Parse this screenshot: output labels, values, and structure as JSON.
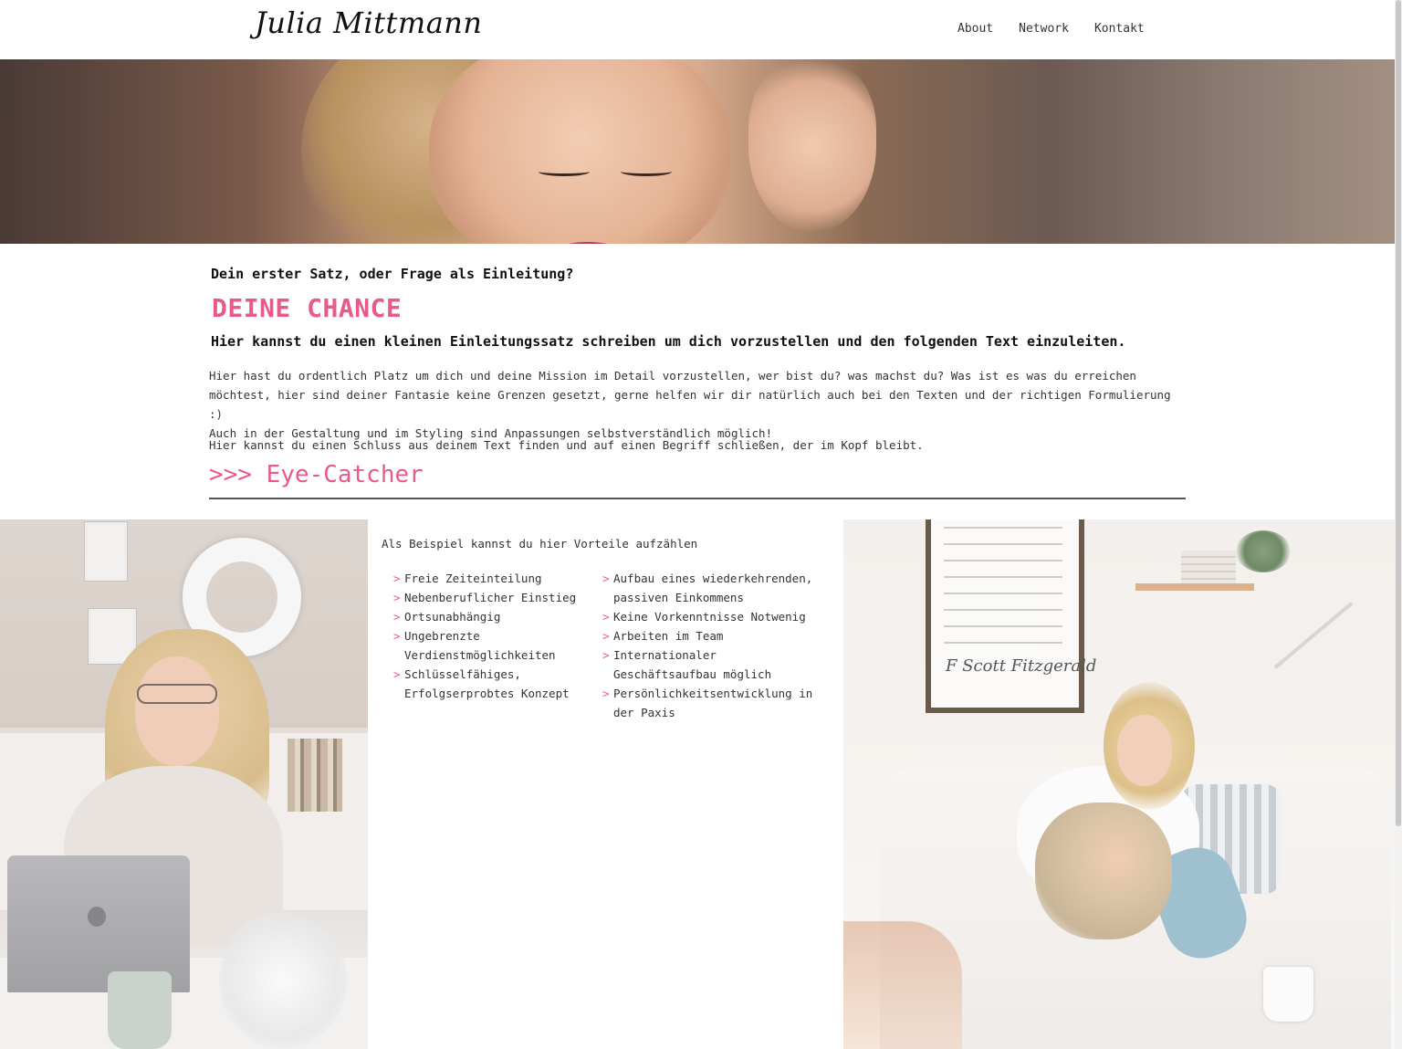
{
  "header": {
    "logo": "Julia Mittmann",
    "nav": [
      {
        "label": "About"
      },
      {
        "label": "Network"
      },
      {
        "label": "Kontakt"
      }
    ]
  },
  "intro": {
    "question": "Dein erster Satz, oder Frage als Einleitung?",
    "title": "DEINE CHANCE",
    "lead": "Hier kannst du einen kleinen Einleitungssatz schreiben um dich vorzustellen und den folgenden Text einzuleiten.",
    "body_lines": [
      "Hier hast du ordentlich Platz um dich und deine Mission im Detail vorzustellen, wer bist du? was machst du? Was ist es was du erreichen",
      "möchtest, hier sind deiner Fantasie keine Grenzen gesetzt, gerne helfen wir dir natürlich auch bei den Texten und der richtigen Formulierung :)",
      "Auch in der Gestaltung und im Styling sind Anpassungen selbstverständlich möglich!"
    ],
    "closing": "Hier kannst du einen Schluss aus deinem Text finden und auf einen Begriff schließen, der im Kopf bleibt.",
    "eye_catcher": ">>> Eye-Catcher"
  },
  "benefits": {
    "title": "Als Beispiel kannst du hier Vorteile aufzählen",
    "bullet": ">",
    "column1": [
      "Freie Zeiteinteilung",
      "Nebenberuflicher Einstieg",
      "Ortsunabhängig",
      "Ungebrenzte Verdienstmöglichkeiten",
      "Schlüsselfähiges, Erfolgserprobtes Konzept"
    ],
    "column2": [
      "Aufbau eines wiederkehrenden, passiven Einkommens",
      "Keine Vorkenntnisse Notwenig",
      "Arbeiten im Team",
      "Internationaler Geschäftsaufbau möglich",
      "Persönlichkeitsentwicklung in der Paxis"
    ]
  },
  "photo_right": {
    "poster_signature": "F Scott Fitzgerald"
  },
  "colors": {
    "accent": "#e85a8a",
    "text": "#222222",
    "divider": "#555555"
  }
}
